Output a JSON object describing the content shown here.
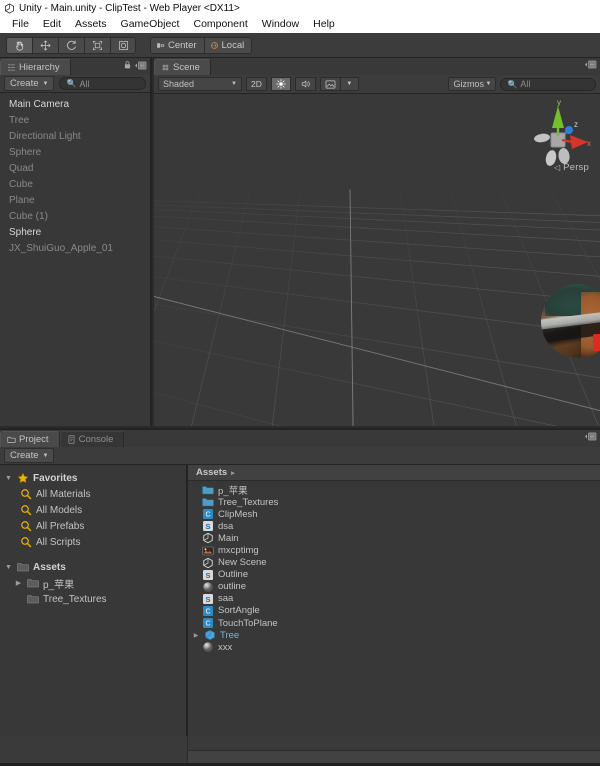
{
  "titlebar": {
    "text": "Unity - Main.unity - ClipTest - Web Player <DX11>",
    "logo_icon": "unity-logo-icon"
  },
  "menubar": {
    "items": [
      {
        "label": "File"
      },
      {
        "label": "Edit"
      },
      {
        "label": "Assets"
      },
      {
        "label": "GameObject"
      },
      {
        "label": "Component"
      },
      {
        "label": "Window"
      },
      {
        "label": "Help"
      }
    ]
  },
  "toolbar": {
    "transform_tools": [
      {
        "name": "hand-tool",
        "icon": "hand-icon",
        "active": true
      },
      {
        "name": "move-tool",
        "icon": "move-arrows-icon",
        "active": false
      },
      {
        "name": "rotate-tool",
        "icon": "rotate-icon",
        "active": false
      },
      {
        "name": "scale-tool",
        "icon": "scale-icon",
        "active": false
      },
      {
        "name": "rect-tool",
        "icon": "rect-transform-icon",
        "active": false
      }
    ],
    "pivot_mode_label": "Center",
    "pivot_rotation_label": "Local"
  },
  "hierarchy": {
    "tab_label": "Hierarchy",
    "tab_icon": "hierarchy-icon",
    "create_label": "Create",
    "search_value": "All",
    "search_placeholder": "All",
    "lock_icon": "lock-icon",
    "menu_icon": "panel-menu-icon",
    "items": [
      {
        "label": "Main Camera",
        "active": true
      },
      {
        "label": "Tree",
        "active": false
      },
      {
        "label": "Directional Light",
        "active": false
      },
      {
        "label": "Sphere",
        "active": false
      },
      {
        "label": "Quad",
        "active": false
      },
      {
        "label": "Cube",
        "active": false
      },
      {
        "label": "Plane",
        "active": false
      },
      {
        "label": "Cube (1)",
        "active": false
      },
      {
        "label": "Sphere",
        "active": true
      },
      {
        "label": "JX_ShuiGuo_Apple_01",
        "active": false
      }
    ]
  },
  "scene": {
    "tab_label": "Scene",
    "tab_icon": "scene-icon",
    "draw_mode": "Shaded",
    "mode_2d_label": "2D",
    "lighting_icon": "sun-icon",
    "audio_icon": "speaker-icon",
    "effects_icon": "image-effects-icon",
    "gizmos_label": "Gizmos",
    "gizmo_search_value": "All",
    "gizmo_search_placeholder": "All",
    "projection_label": "Persp",
    "axis_labels": {
      "x": "x",
      "y": "y",
      "z": "z"
    },
    "axis_colors": {
      "x": "#d8352a",
      "y": "#72c02c",
      "z": "#2f7fd8"
    }
  },
  "project": {
    "tabs": [
      {
        "label": "Project",
        "icon": "project-folder-icon",
        "active": true
      },
      {
        "label": "Console",
        "icon": "console-icon",
        "active": false
      }
    ],
    "create_label": "Create",
    "breadcrumb": "Assets",
    "breadcrumb_arrow": "▸",
    "tree": [
      {
        "label": "Favorites",
        "icon": "star-icon",
        "arrow": "▼",
        "indent": 0,
        "bold": true
      },
      {
        "label": "All Materials",
        "icon": "search-icon",
        "arrow": "",
        "indent": 1,
        "bold": false
      },
      {
        "label": "All Models",
        "icon": "search-icon",
        "arrow": "",
        "indent": 1,
        "bold": false
      },
      {
        "label": "All Prefabs",
        "icon": "search-icon",
        "arrow": "",
        "indent": 1,
        "bold": false
      },
      {
        "label": "All Scripts",
        "icon": "search-icon",
        "arrow": "",
        "indent": 1,
        "bold": false
      },
      {
        "label": "Assets",
        "icon": "folder-icon",
        "arrow": "▼",
        "indent": 0,
        "bold": true
      },
      {
        "label": "p_苹果",
        "icon": "folder-icon",
        "arrow": "▶",
        "indent": 1,
        "bold": false
      },
      {
        "label": "Tree_Textures",
        "icon": "folder-icon",
        "arrow": "",
        "indent": 1,
        "bold": false
      }
    ],
    "assets": [
      {
        "label": "p_苹果",
        "icon": "folder-icon",
        "arrow": ""
      },
      {
        "label": "Tree_Textures",
        "icon": "folder-icon",
        "arrow": ""
      },
      {
        "label": "ClipMesh",
        "icon": "csharp-script-icon",
        "arrow": ""
      },
      {
        "label": "dsa",
        "icon": "shader-icon",
        "arrow": ""
      },
      {
        "label": "Main",
        "icon": "scene-asset-icon",
        "arrow": ""
      },
      {
        "label": "mxcptimg",
        "icon": "texture-icon",
        "arrow": ""
      },
      {
        "label": "New Scene",
        "icon": "scene-asset-icon",
        "arrow": ""
      },
      {
        "label": "Outline",
        "icon": "shader-icon",
        "arrow": ""
      },
      {
        "label": "outline",
        "icon": "material-icon",
        "arrow": ""
      },
      {
        "label": "saa",
        "icon": "shader-icon",
        "arrow": ""
      },
      {
        "label": "SortAngle",
        "icon": "csharp-script-icon",
        "arrow": ""
      },
      {
        "label": "TouchToPlane",
        "icon": "csharp-script-icon",
        "arrow": ""
      },
      {
        "label": "Tree",
        "icon": "prefab-icon",
        "arrow": "▶"
      },
      {
        "label": "xxx",
        "icon": "material-icon",
        "arrow": ""
      }
    ]
  },
  "colors": {
    "panel_bg": "#383838",
    "toolbar_bg": "#3c3c3c",
    "accent_red": "#e02a20",
    "star_yellow": "#e8b400",
    "folder_blue": "#4e9dc4"
  }
}
